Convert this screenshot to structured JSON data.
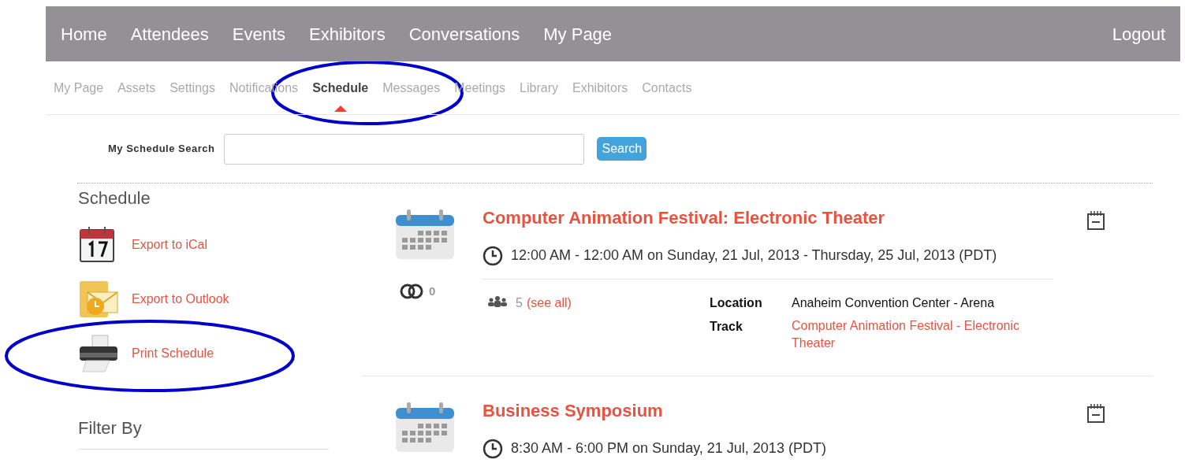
{
  "top_nav": {
    "items": [
      {
        "label": "Home"
      },
      {
        "label": "Attendees"
      },
      {
        "label": "Events"
      },
      {
        "label": "Exhibitors"
      },
      {
        "label": "Conversations"
      },
      {
        "label": "My Page"
      }
    ],
    "logout": "Logout"
  },
  "sub_nav": [
    {
      "label": "My Page",
      "selected": false
    },
    {
      "label": "Assets",
      "selected": false
    },
    {
      "label": "Settings",
      "selected": false
    },
    {
      "label": "Notifications",
      "selected": false
    },
    {
      "label": "Schedule",
      "selected": true
    },
    {
      "label": "Messages",
      "selected": false
    },
    {
      "label": "Meetings",
      "selected": false
    },
    {
      "label": "Library",
      "selected": false
    },
    {
      "label": "Exhibitors",
      "selected": false
    },
    {
      "label": "Contacts",
      "selected": false
    }
  ],
  "search": {
    "label": "My Schedule Search",
    "button": "Search"
  },
  "sidebar": {
    "title": "Schedule",
    "actions": [
      {
        "kind": "ical",
        "label": "Export to iCal"
      },
      {
        "kind": "outlook",
        "label": "Export to Outlook"
      },
      {
        "kind": "print",
        "label": "Print Schedule"
      }
    ],
    "filter_title": "Filter By"
  },
  "events": [
    {
      "title": "Computer Animation Festival: Electronic Theater",
      "time": "12:00 AM - 12:00 AM on Sunday, 21 Jul, 2013 - Thursday, 25 Jul, 2013 (PDT)",
      "conversations": "0",
      "attendees": "5",
      "see_all": "(see all)",
      "details": [
        {
          "label": "Location",
          "value": "Anaheim Convention Center - Arena",
          "kind": "text"
        },
        {
          "label": "Track",
          "value": "Computer Animation Festival - Electronic Theater",
          "kind": "link"
        }
      ]
    },
    {
      "title": "Business Symposium",
      "time": "8:30 AM - 6:00 PM on Sunday, 21 Jul, 2013 (PDT)"
    }
  ],
  "annotations": [
    {
      "kind": "ellipse",
      "color": "#0000cc"
    },
    {
      "kind": "ellipse",
      "color": "#0000cc"
    }
  ]
}
